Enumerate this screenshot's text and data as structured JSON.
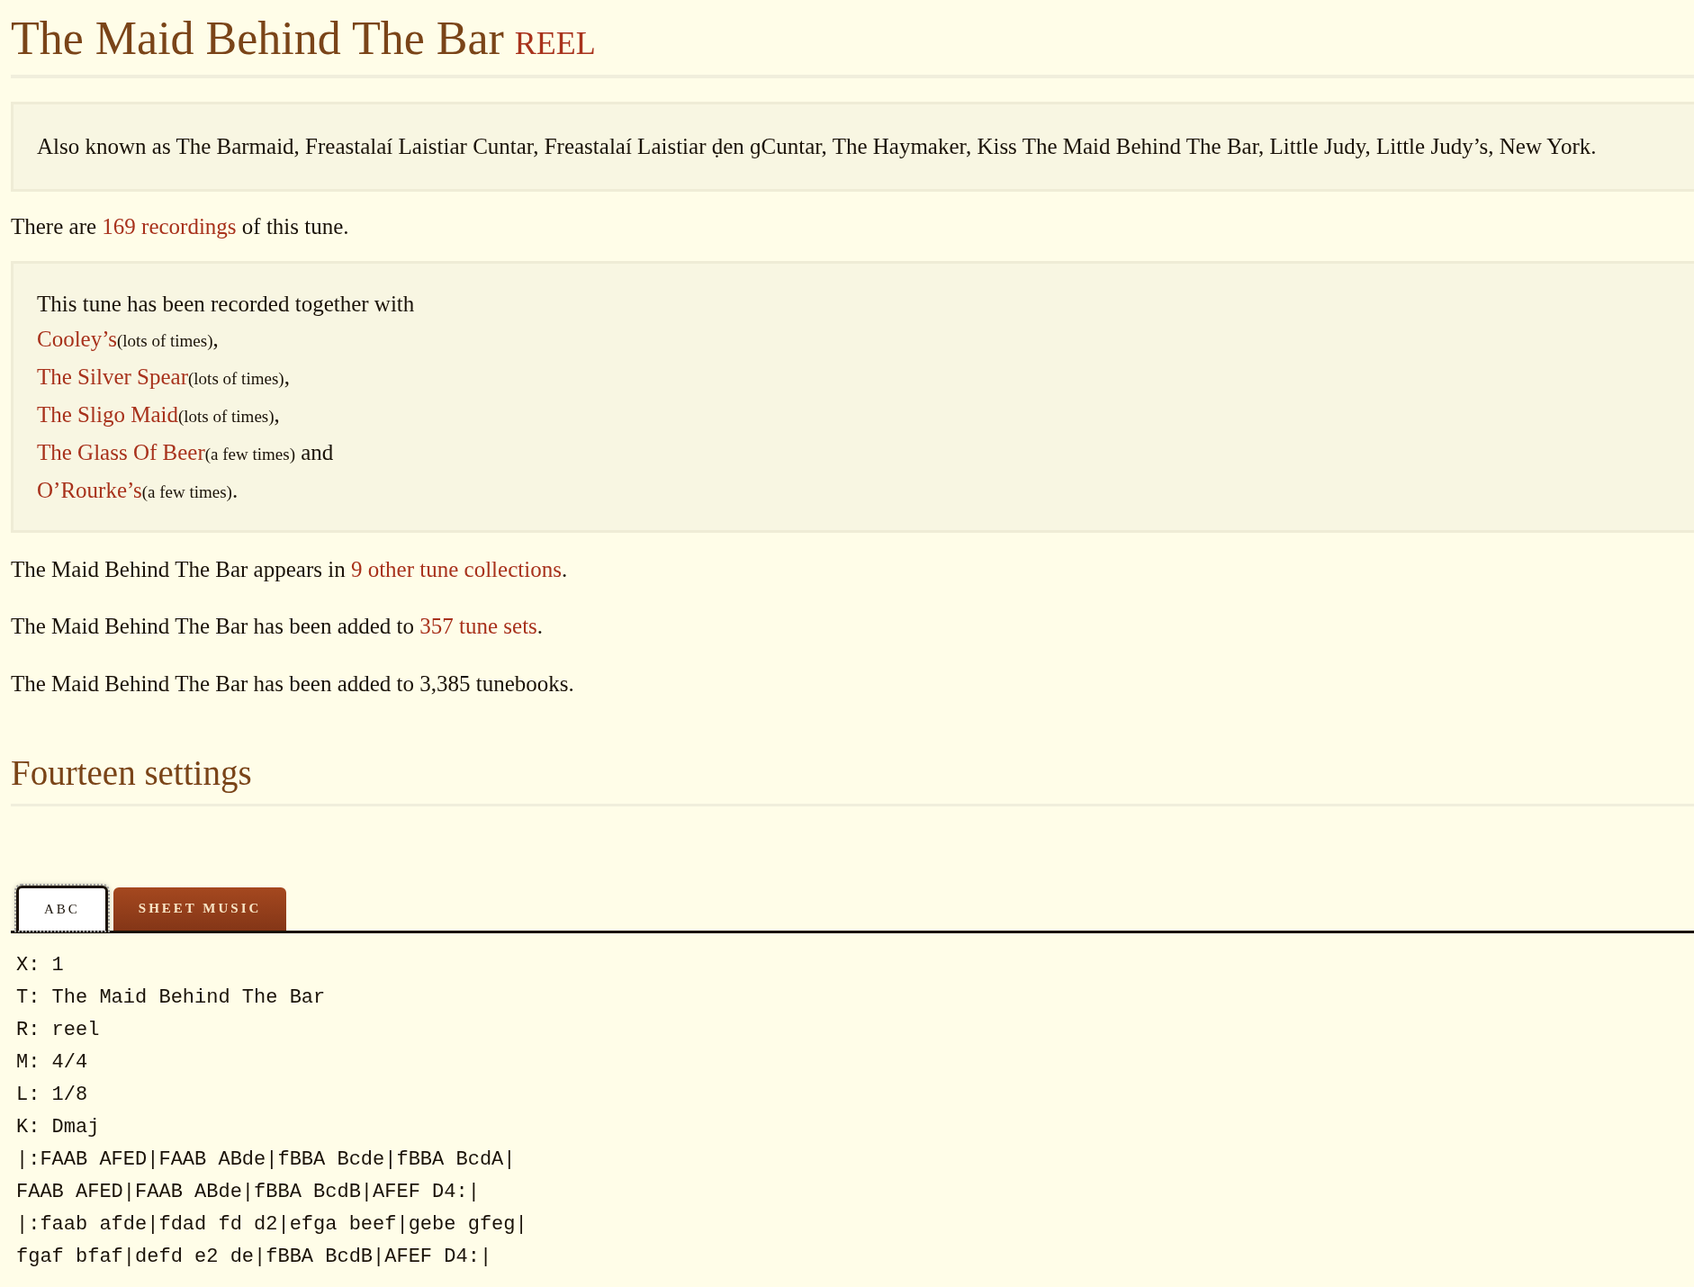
{
  "title": "The Maid Behind The Bar",
  "tune_type": "REEL",
  "also_known_as": "Also known as The Barmaid, Freastalaí Laistiar Cuntar, Freastalaí Laistiar ḍen ɡCuntar, The Haymaker, Kiss The Maid Behind The Bar, Little Judy, Little Judy’s, New York.",
  "recordings": {
    "before": "There are ",
    "link": "169 recordings",
    "after": " of this tune."
  },
  "recorded_with": {
    "intro": "This tune has been recorded together with",
    "items": [
      {
        "link": "Cooley’s",
        "note": "(lots of times)",
        "suffix": ","
      },
      {
        "link": "The Silver Spear",
        "note": "(lots of times)",
        "suffix": ","
      },
      {
        "link": "The Sligo Maid",
        "note": "(lots of times)",
        "suffix": ","
      },
      {
        "link": "The Glass Of Beer",
        "note": "(a few times)",
        "suffix": " and"
      },
      {
        "link": "O’Rourke’s",
        "note": "(a few times)",
        "suffix": "."
      }
    ]
  },
  "stats": [
    {
      "before": "The Maid Behind The Bar appears in ",
      "link": "9 other tune collections",
      "after": "."
    },
    {
      "before": "The Maid Behind The Bar has been added to ",
      "link": "357 tune sets",
      "after": "."
    },
    {
      "before": "The Maid Behind The Bar has been added to 3,385 tunebooks."
    }
  ],
  "settings_heading": "Fourteen settings",
  "tabs": [
    {
      "label": "ABC",
      "selected": true
    },
    {
      "label": "SHEET MUSIC",
      "selected": false
    }
  ],
  "abc_lines": [
    "X: 1",
    "T: The Maid Behind The Bar",
    "R: reel",
    "M: 4/4",
    "L: 1/8",
    "K: Dmaj",
    "|:FAAB AFED|FAAB ABde|fBBA Bcde|fBBA BcdA|",
    "FAAB AFED|FAAB ABde|fBBA BcdB|AFEF D4:|",
    "|:faab afde|fdad fd d2|efga beef|gebe gfeg|",
    "fgaf bfaf|defd e2 de|fBBA BcdB|AFEF D4:|"
  ]
}
